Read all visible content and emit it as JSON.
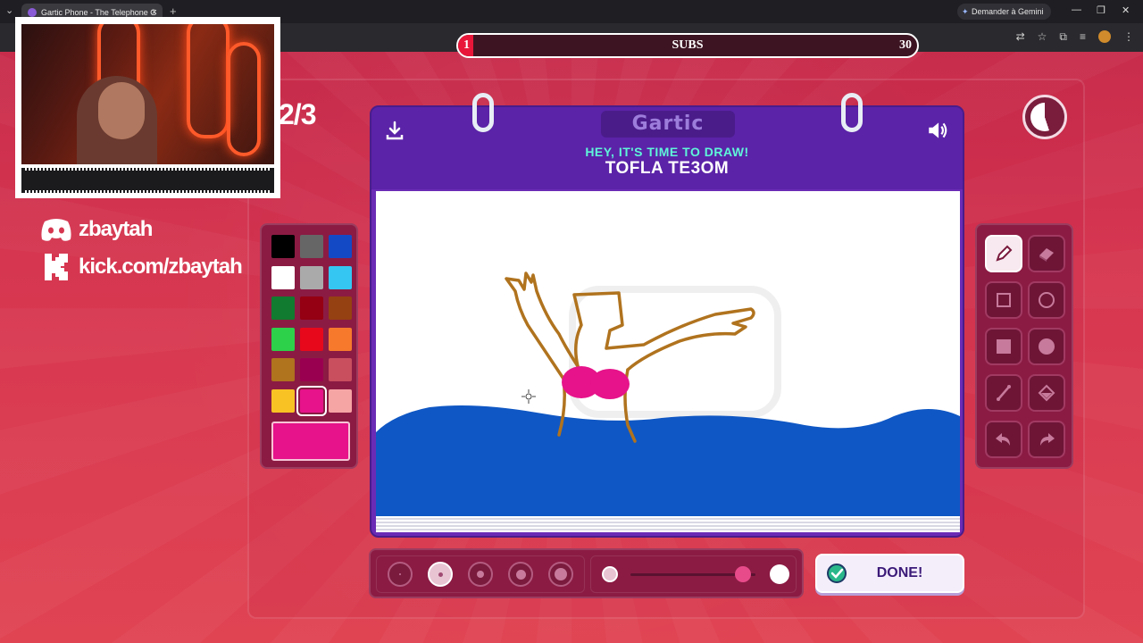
{
  "browser": {
    "tab_title": "Gartic Phone - The Telephone G",
    "tab_close": "×",
    "new_tab": "+",
    "gemini_label": "Demander à Gemini",
    "window_controls": [
      "—",
      "❐",
      "✕"
    ]
  },
  "stream": {
    "subs_label": "SUBS",
    "subs_current": "1",
    "subs_goal": "30",
    "subs_progress": 0.033,
    "discord_handle": "zbaytah",
    "kick_url": "kick.com/zbaytah"
  },
  "game": {
    "round": "2/3",
    "logo": "Gartic",
    "instruction": "HEY, IT'S TIME TO DRAW!",
    "word": "TOFLA TE3OM",
    "done_label": "DONE!",
    "timer_fraction_remaining": 0.55
  },
  "palette": {
    "colors": [
      "#000000",
      "#666666",
      "#1449c6",
      "#ffffff",
      "#aaaaaa",
      "#35c7f2",
      "#117b2f",
      "#950012",
      "#964112",
      "#2ed14a",
      "#e7081b",
      "#f77a2c",
      "#b0731e",
      "#9a0050",
      "#c94f5f",
      "#f8c224",
      "#e6138a",
      "#f6a5a5"
    ],
    "selected_index": 16,
    "current_color": "#e6138a"
  },
  "tools": {
    "items": [
      "pencil",
      "eraser",
      "rectangle-outline",
      "ellipse-outline",
      "rectangle-filled",
      "ellipse-filled",
      "line",
      "fill-bucket",
      "undo",
      "redo"
    ],
    "active": "pencil"
  },
  "brush": {
    "sizes": [
      "1",
      "2",
      "3",
      "4",
      "5"
    ],
    "active_index": 1,
    "opacity_value": 0.9
  }
}
